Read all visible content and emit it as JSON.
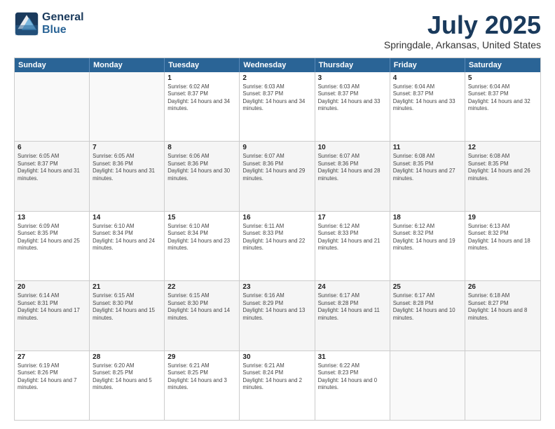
{
  "logo": {
    "line1": "General",
    "line2": "Blue"
  },
  "title": "July 2025",
  "subtitle": "Springdale, Arkansas, United States",
  "weekdays": [
    "Sunday",
    "Monday",
    "Tuesday",
    "Wednesday",
    "Thursday",
    "Friday",
    "Saturday"
  ],
  "weeks": [
    [
      {
        "day": "",
        "empty": true
      },
      {
        "day": "",
        "empty": true
      },
      {
        "day": "1",
        "sunrise": "Sunrise: 6:02 AM",
        "sunset": "Sunset: 8:37 PM",
        "daylight": "Daylight: 14 hours and 34 minutes."
      },
      {
        "day": "2",
        "sunrise": "Sunrise: 6:03 AM",
        "sunset": "Sunset: 8:37 PM",
        "daylight": "Daylight: 14 hours and 34 minutes."
      },
      {
        "day": "3",
        "sunrise": "Sunrise: 6:03 AM",
        "sunset": "Sunset: 8:37 PM",
        "daylight": "Daylight: 14 hours and 33 minutes."
      },
      {
        "day": "4",
        "sunrise": "Sunrise: 6:04 AM",
        "sunset": "Sunset: 8:37 PM",
        "daylight": "Daylight: 14 hours and 33 minutes."
      },
      {
        "day": "5",
        "sunrise": "Sunrise: 6:04 AM",
        "sunset": "Sunset: 8:37 PM",
        "daylight": "Daylight: 14 hours and 32 minutes."
      }
    ],
    [
      {
        "day": "6",
        "sunrise": "Sunrise: 6:05 AM",
        "sunset": "Sunset: 8:37 PM",
        "daylight": "Daylight: 14 hours and 31 minutes."
      },
      {
        "day": "7",
        "sunrise": "Sunrise: 6:05 AM",
        "sunset": "Sunset: 8:36 PM",
        "daylight": "Daylight: 14 hours and 31 minutes."
      },
      {
        "day": "8",
        "sunrise": "Sunrise: 6:06 AM",
        "sunset": "Sunset: 8:36 PM",
        "daylight": "Daylight: 14 hours and 30 minutes."
      },
      {
        "day": "9",
        "sunrise": "Sunrise: 6:07 AM",
        "sunset": "Sunset: 8:36 PM",
        "daylight": "Daylight: 14 hours and 29 minutes."
      },
      {
        "day": "10",
        "sunrise": "Sunrise: 6:07 AM",
        "sunset": "Sunset: 8:36 PM",
        "daylight": "Daylight: 14 hours and 28 minutes."
      },
      {
        "day": "11",
        "sunrise": "Sunrise: 6:08 AM",
        "sunset": "Sunset: 8:35 PM",
        "daylight": "Daylight: 14 hours and 27 minutes."
      },
      {
        "day": "12",
        "sunrise": "Sunrise: 6:08 AM",
        "sunset": "Sunset: 8:35 PM",
        "daylight": "Daylight: 14 hours and 26 minutes."
      }
    ],
    [
      {
        "day": "13",
        "sunrise": "Sunrise: 6:09 AM",
        "sunset": "Sunset: 8:35 PM",
        "daylight": "Daylight: 14 hours and 25 minutes."
      },
      {
        "day": "14",
        "sunrise": "Sunrise: 6:10 AM",
        "sunset": "Sunset: 8:34 PM",
        "daylight": "Daylight: 14 hours and 24 minutes."
      },
      {
        "day": "15",
        "sunrise": "Sunrise: 6:10 AM",
        "sunset": "Sunset: 8:34 PM",
        "daylight": "Daylight: 14 hours and 23 minutes."
      },
      {
        "day": "16",
        "sunrise": "Sunrise: 6:11 AM",
        "sunset": "Sunset: 8:33 PM",
        "daylight": "Daylight: 14 hours and 22 minutes."
      },
      {
        "day": "17",
        "sunrise": "Sunrise: 6:12 AM",
        "sunset": "Sunset: 8:33 PM",
        "daylight": "Daylight: 14 hours and 21 minutes."
      },
      {
        "day": "18",
        "sunrise": "Sunrise: 6:12 AM",
        "sunset": "Sunset: 8:32 PM",
        "daylight": "Daylight: 14 hours and 19 minutes."
      },
      {
        "day": "19",
        "sunrise": "Sunrise: 6:13 AM",
        "sunset": "Sunset: 8:32 PM",
        "daylight": "Daylight: 14 hours and 18 minutes."
      }
    ],
    [
      {
        "day": "20",
        "sunrise": "Sunrise: 6:14 AM",
        "sunset": "Sunset: 8:31 PM",
        "daylight": "Daylight: 14 hours and 17 minutes."
      },
      {
        "day": "21",
        "sunrise": "Sunrise: 6:15 AM",
        "sunset": "Sunset: 8:30 PM",
        "daylight": "Daylight: 14 hours and 15 minutes."
      },
      {
        "day": "22",
        "sunrise": "Sunrise: 6:15 AM",
        "sunset": "Sunset: 8:30 PM",
        "daylight": "Daylight: 14 hours and 14 minutes."
      },
      {
        "day": "23",
        "sunrise": "Sunrise: 6:16 AM",
        "sunset": "Sunset: 8:29 PM",
        "daylight": "Daylight: 14 hours and 13 minutes."
      },
      {
        "day": "24",
        "sunrise": "Sunrise: 6:17 AM",
        "sunset": "Sunset: 8:28 PM",
        "daylight": "Daylight: 14 hours and 11 minutes."
      },
      {
        "day": "25",
        "sunrise": "Sunrise: 6:17 AM",
        "sunset": "Sunset: 8:28 PM",
        "daylight": "Daylight: 14 hours and 10 minutes."
      },
      {
        "day": "26",
        "sunrise": "Sunrise: 6:18 AM",
        "sunset": "Sunset: 8:27 PM",
        "daylight": "Daylight: 14 hours and 8 minutes."
      }
    ],
    [
      {
        "day": "27",
        "sunrise": "Sunrise: 6:19 AM",
        "sunset": "Sunset: 8:26 PM",
        "daylight": "Daylight: 14 hours and 7 minutes."
      },
      {
        "day": "28",
        "sunrise": "Sunrise: 6:20 AM",
        "sunset": "Sunset: 8:25 PM",
        "daylight": "Daylight: 14 hours and 5 minutes."
      },
      {
        "day": "29",
        "sunrise": "Sunrise: 6:21 AM",
        "sunset": "Sunset: 8:25 PM",
        "daylight": "Daylight: 14 hours and 3 minutes."
      },
      {
        "day": "30",
        "sunrise": "Sunrise: 6:21 AM",
        "sunset": "Sunset: 8:24 PM",
        "daylight": "Daylight: 14 hours and 2 minutes."
      },
      {
        "day": "31",
        "sunrise": "Sunrise: 6:22 AM",
        "sunset": "Sunset: 8:23 PM",
        "daylight": "Daylight: 14 hours and 0 minutes."
      },
      {
        "day": "",
        "empty": true
      },
      {
        "day": "",
        "empty": true
      }
    ]
  ]
}
